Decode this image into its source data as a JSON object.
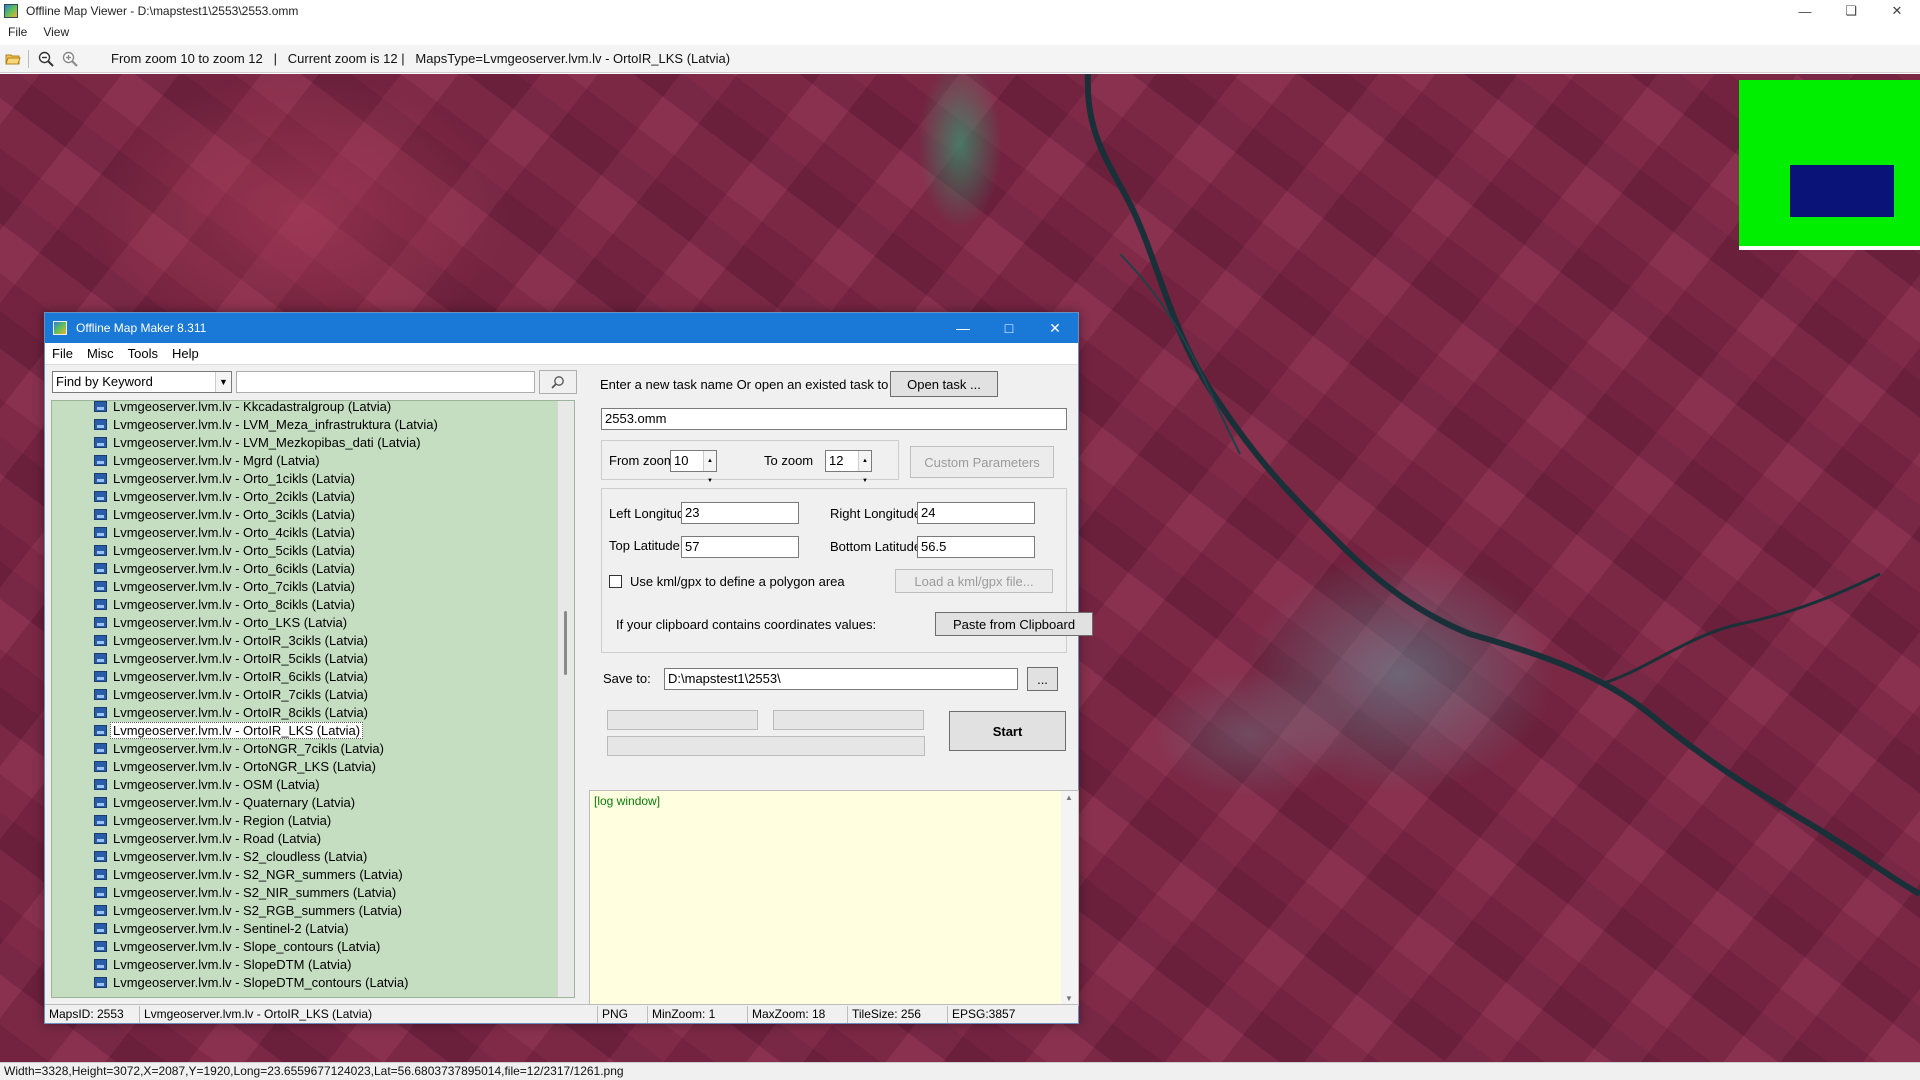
{
  "viewer": {
    "title": "Offline Map Viewer - D:\\mapstest1\\2553\\2553.omm",
    "menu": [
      "File",
      "View"
    ],
    "toolbar": {
      "open_icon": "folder-open-icon",
      "zoom_out_icon": "zoom-out-icon",
      "zoom_in_icon": "zoom-in-icon",
      "info": "From zoom 10 to zoom 12   |   Current zoom is 12 |   MapsType=Lvmgeoserver.lvm.lv - OrtoIR_LKS (Latvia)"
    },
    "status": "Width=3328,Height=3072,X=2087,Y=1920,Long=23.6559677124023,Lat=56.6803737895014,file=12/2317/1261.png",
    "minimap_colors": {
      "background": "#00ee00",
      "viewport": "#0a1478"
    }
  },
  "dialog": {
    "title": "Offline Map Maker 8.311",
    "menu": [
      "File",
      "Misc",
      "Tools",
      "Help"
    ],
    "search": {
      "mode": "Find by Keyword",
      "keyword": ""
    },
    "tree_items": [
      "Lvmgeoserver.lvm.lv - Kkcadastralgroup (Latvia)",
      "Lvmgeoserver.lvm.lv - LVM_Meza_infrastruktura (Latvia)",
      "Lvmgeoserver.lvm.lv - LVM_Mezkopibas_dati (Latvia)",
      "Lvmgeoserver.lvm.lv - Mgrd (Latvia)",
      "Lvmgeoserver.lvm.lv - Orto_1cikls (Latvia)",
      "Lvmgeoserver.lvm.lv - Orto_2cikls (Latvia)",
      "Lvmgeoserver.lvm.lv - Orto_3cikls (Latvia)",
      "Lvmgeoserver.lvm.lv - Orto_4cikls (Latvia)",
      "Lvmgeoserver.lvm.lv - Orto_5cikls (Latvia)",
      "Lvmgeoserver.lvm.lv - Orto_6cikls (Latvia)",
      "Lvmgeoserver.lvm.lv - Orto_7cikls (Latvia)",
      "Lvmgeoserver.lvm.lv - Orto_8cikls (Latvia)",
      "Lvmgeoserver.lvm.lv - Orto_LKS (Latvia)",
      "Lvmgeoserver.lvm.lv - OrtoIR_3cikls (Latvia)",
      "Lvmgeoserver.lvm.lv - OrtoIR_5cikls (Latvia)",
      "Lvmgeoserver.lvm.lv - OrtoIR_6cikls (Latvia)",
      "Lvmgeoserver.lvm.lv - OrtoIR_7cikls (Latvia)",
      "Lvmgeoserver.lvm.lv - OrtoIR_8cikls (Latvia)",
      "Lvmgeoserver.lvm.lv - OrtoIR_LKS (Latvia)",
      "Lvmgeoserver.lvm.lv - OrtoNGR_7cikls (Latvia)",
      "Lvmgeoserver.lvm.lv - OrtoNGR_LKS (Latvia)",
      "Lvmgeoserver.lvm.lv - OSM (Latvia)",
      "Lvmgeoserver.lvm.lv - Quaternary (Latvia)",
      "Lvmgeoserver.lvm.lv - Region (Latvia)",
      "Lvmgeoserver.lvm.lv - Road (Latvia)",
      "Lvmgeoserver.lvm.lv - S2_cloudless (Latvia)",
      "Lvmgeoserver.lvm.lv - S2_NGR_summers (Latvia)",
      "Lvmgeoserver.lvm.lv - S2_NIR_summers (Latvia)",
      "Lvmgeoserver.lvm.lv - S2_RGB_summers (Latvia)",
      "Lvmgeoserver.lvm.lv - Sentinel-2 (Latvia)",
      "Lvmgeoserver.lvm.lv - Slope_contours (Latvia)",
      "Lvmgeoserver.lvm.lv - SlopeDTM (Latvia)",
      "Lvmgeoserver.lvm.lv - SlopeDTM_contours (Latvia)"
    ],
    "selected_index": 18,
    "task_prompt": "Enter a new task name Or open an existed task to continue:",
    "open_task_label": "Open task ...",
    "task_name": "2553.omm",
    "from_zoom_label": "From zoom",
    "from_zoom": "10",
    "to_zoom_label": "To zoom",
    "to_zoom": "12",
    "custom_params_label": "Custom Parameters",
    "left_lon_label": "Left Longitude",
    "left_lon": "23",
    "right_lon_label": "Right Longitude",
    "right_lon": "24",
    "top_lat_label": "Top Latitude",
    "top_lat": "57",
    "bottom_lat_label": "Bottom Latitude",
    "bottom_lat": "56.5",
    "kml_label": "Use kml/gpx to define a polygon area",
    "kml_checked": false,
    "load_kml_label": "Load a kml/gpx file...",
    "clipboard_label": "If your clipboard contains coordinates values:",
    "paste_label": "Paste from Clipboard",
    "save_to_label": "Save to:",
    "save_to": "D:\\mapstest1\\2553\\",
    "browse_label": "...",
    "start_label": "Start",
    "log_text": "[log window]",
    "status": {
      "maps_id": "MapsID: 2553",
      "maps_name": "Lvmgeoserver.lvm.lv - OrtoIR_LKS (Latvia)",
      "format": "PNG",
      "min_zoom": "MinZoom: 1",
      "max_zoom": "MaxZoom: 18",
      "tile_size": "TileSize: 256",
      "epsg": "EPSG:3857"
    }
  }
}
